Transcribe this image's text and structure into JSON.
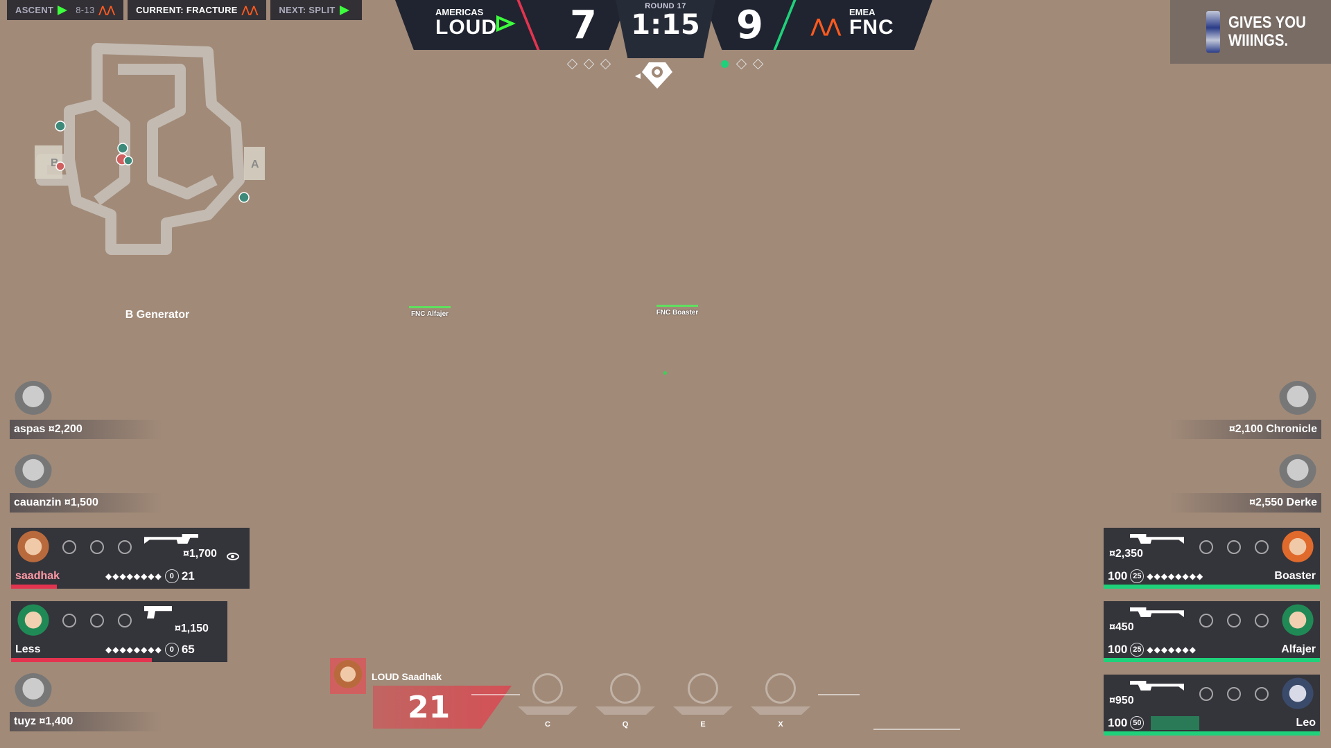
{
  "mapbar": {
    "previous": {
      "map": "ASCENT",
      "score": "8-13"
    },
    "current": {
      "label": "CURRENT:",
      "map": "FRACTURE"
    },
    "next": {
      "label": "NEXT:",
      "map": "SPLIT"
    }
  },
  "scoreboard": {
    "left": {
      "region": "AMERICAS",
      "team": "LOUD",
      "score": "7"
    },
    "right": {
      "region": "EMEA",
      "team": "FNC",
      "score": "9"
    },
    "round": "ROUND 17",
    "clock": "1:15"
  },
  "sponsor": {
    "line1": "GIVES YOU",
    "line2": "WIIINGS."
  },
  "minimap": {
    "site_a": "A",
    "site_b": "B",
    "location": "B Generator"
  },
  "world_tags": [
    {
      "label": "FNC Alfajer"
    },
    {
      "label": "FNC Boaster"
    }
  ],
  "left_team": {
    "dead": [
      {
        "name": "aspas",
        "credits": "¤2,200"
      },
      {
        "name": "cauanzin",
        "credits": "¤1,500"
      },
      {
        "name": "tuyz",
        "credits": "¤1,400"
      }
    ],
    "alive": [
      {
        "name": "saadhak",
        "credits": "¤1,700",
        "shield": "0",
        "hp": "21",
        "hp_fraction": 0.21
      },
      {
        "name": "Less",
        "credits": "¤1,150",
        "shield": "0",
        "hp": "65",
        "hp_fraction": 0.65
      }
    ]
  },
  "right_team": {
    "dead": [
      {
        "name": "Chronicle",
        "credits": "¤2,100"
      },
      {
        "name": "Derke",
        "credits": "¤2,550"
      }
    ],
    "alive": [
      {
        "name": "Boaster",
        "credits": "¤2,350",
        "hp": "100",
        "shield": "25",
        "hp_fraction": 1.0
      },
      {
        "name": "Alfajer",
        "credits": "¤450",
        "hp": "100",
        "shield": "25",
        "hp_fraction": 1.0
      },
      {
        "name": "Leo",
        "credits": "¤950",
        "hp": "100",
        "shield": "50",
        "hp_fraction": 1.0
      }
    ]
  },
  "hud": {
    "player": "LOUD Saadhak",
    "health": "21",
    "abilities": [
      {
        "key": "C"
      },
      {
        "key": "Q"
      },
      {
        "key": "E"
      },
      {
        "key": "X"
      }
    ]
  },
  "colors": {
    "loud_green": "#3dff3d",
    "fnc_orange": "#ff5a1f",
    "attacker_red": "#e3344f",
    "defender_green": "#1fd17a"
  }
}
